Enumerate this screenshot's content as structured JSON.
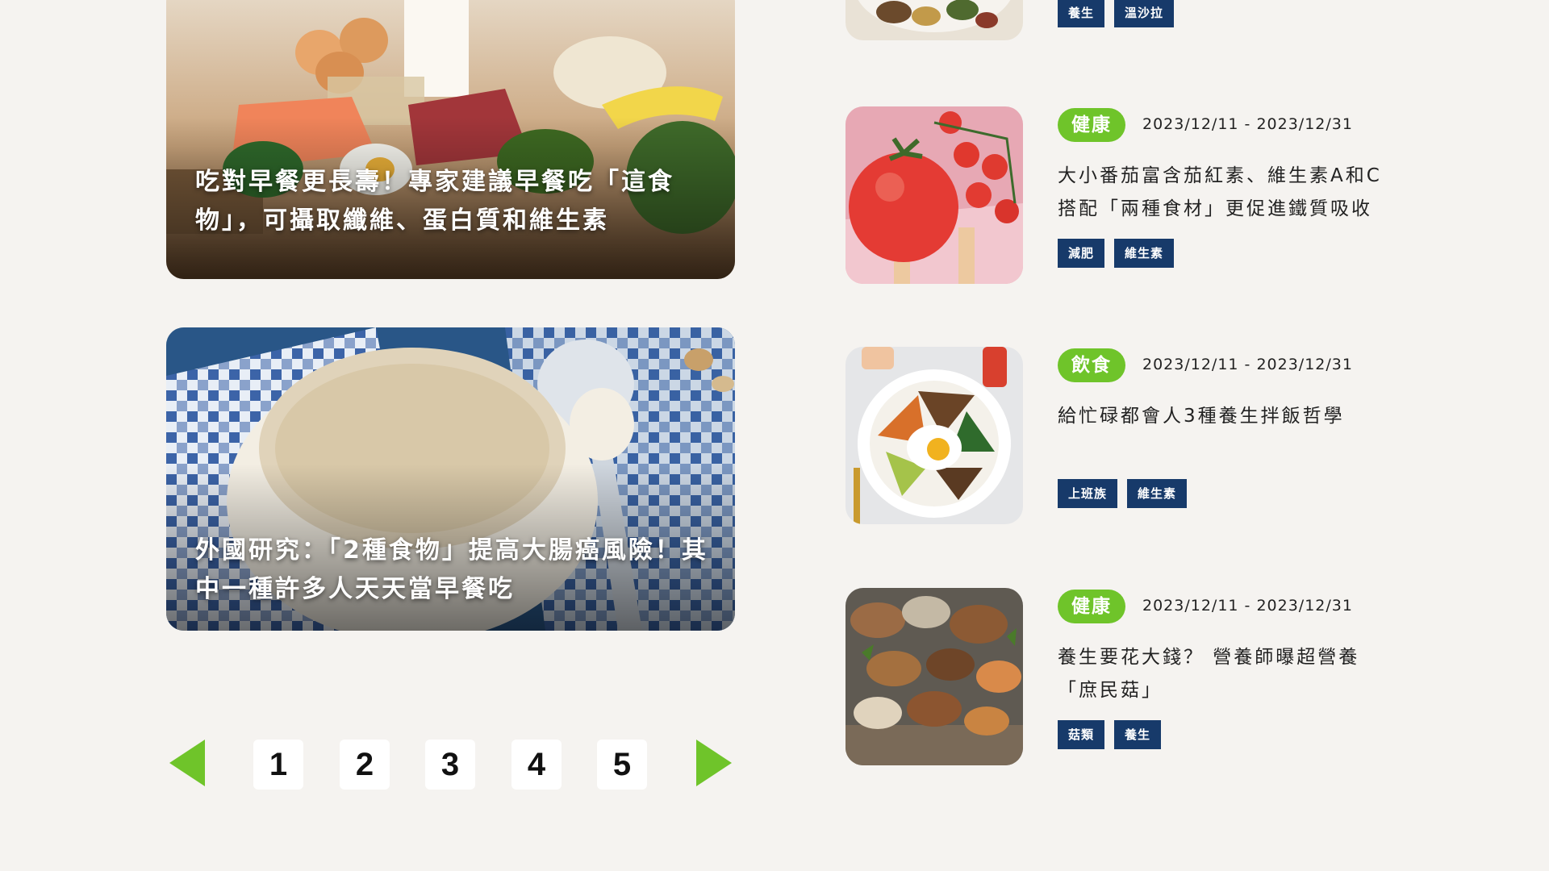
{
  "featured": [
    {
      "title": "吃對早餐更長壽！專家建議早餐吃「這食物」，可攝取纖維、蛋白質和維生素"
    },
    {
      "title": "外國研究：「2種食物」提高大腸癌風險！其中一種許多人天天當早餐吃"
    }
  ],
  "pagination": {
    "prev_icon": "prev-arrow-icon",
    "next_icon": "next-arrow-icon",
    "pages": [
      "1",
      "2",
      "3",
      "4",
      "5"
    ]
  },
  "top_partial": {
    "tags": [
      "養生",
      "溫沙拉"
    ]
  },
  "articles": [
    {
      "category": "健康",
      "date": "2023/12/11 - 2023/12/31",
      "headline": "大小番茄富含茄紅素、維生素A和C搭配「兩種食材」更促進鐵質吸收",
      "tags": [
        "減肥",
        "維生素"
      ]
    },
    {
      "category": "飲食",
      "date": "2023/12/11 - 2023/12/31",
      "headline": "給忙碌都會人3種養生拌飯哲學",
      "tags": [
        "上班族",
        "維生素"
      ]
    },
    {
      "category": "健康",
      "date": "2023/12/11 - 2023/12/31",
      "headline": "養生要花大錢？ 營養師曝超營養「庶民菇」",
      "tags": [
        "菇類",
        "養生"
      ]
    }
  ],
  "colors": {
    "accent": "#6fc42a",
    "tag_bg": "#173a6a",
    "page_bg": "#f5f3f0"
  }
}
